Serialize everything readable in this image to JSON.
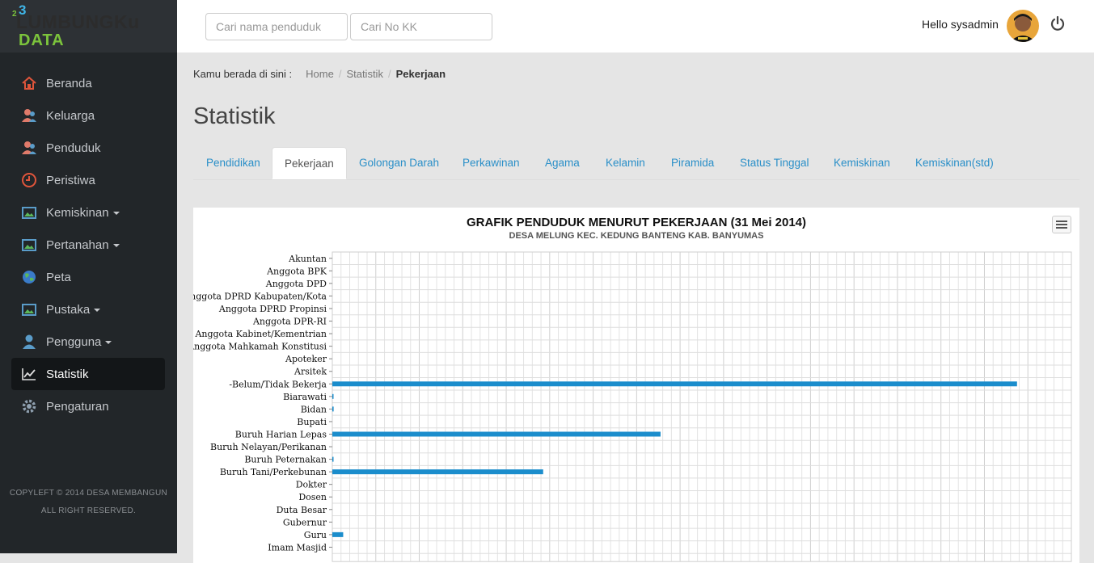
{
  "logo": {
    "mark_small": "2",
    "mark_big": "3",
    "name": "LUMBUNGKu",
    "sub": "DATA"
  },
  "sidebar": {
    "items": [
      {
        "label": "Beranda",
        "icon": "home-icon",
        "caret": false,
        "color": "#e0553b"
      },
      {
        "label": "Keluarga",
        "icon": "family-icon",
        "caret": false,
        "color": "#e07a6a"
      },
      {
        "label": "Penduduk",
        "icon": "people-icon",
        "caret": false,
        "color": "#e07a6a"
      },
      {
        "label": "Peristiwa",
        "icon": "clock-icon",
        "caret": false,
        "color": "#e0553b"
      },
      {
        "label": "Kemiskinan",
        "icon": "image-icon",
        "caret": true,
        "color": "#5a9cc9"
      },
      {
        "label": "Pertanahan",
        "icon": "image-icon",
        "caret": true,
        "color": "#5a9cc9"
      },
      {
        "label": "Peta",
        "icon": "globe-icon",
        "caret": false,
        "color": "#5cb85c"
      },
      {
        "label": "Pustaka",
        "icon": "image-icon",
        "caret": true,
        "color": "#5a9cc9"
      },
      {
        "label": "Pengguna",
        "icon": "user-icon",
        "caret": true,
        "color": "#5a9cc9"
      },
      {
        "label": "Statistik",
        "icon": "chart-line-icon",
        "caret": false,
        "color": "#e0e0e0",
        "active": true
      },
      {
        "label": "Pengaturan",
        "icon": "gear-icon",
        "caret": false,
        "color": "#8fa0b0"
      }
    ],
    "footer_line1": "COPYLEFT © 2014 DESA MEMBANGUN",
    "footer_line2": "ALL RIGHT RESERVED."
  },
  "topbar": {
    "search_name_placeholder": "Cari nama penduduk",
    "search_kk_placeholder": "Cari No KK",
    "greeting": "Hello sysadmin"
  },
  "breadcrumb": {
    "label": "Kamu berada di sini :",
    "items": [
      "Home",
      "Statistik",
      "Pekerjaan"
    ]
  },
  "page": {
    "title": "Statistik"
  },
  "tabs": [
    {
      "label": "Pendidikan"
    },
    {
      "label": "Pekerjaan",
      "active": true
    },
    {
      "label": "Golongan Darah"
    },
    {
      "label": "Perkawinan"
    },
    {
      "label": "Agama"
    },
    {
      "label": "Kelamin"
    },
    {
      "label": "Piramida"
    },
    {
      "label": "Status Tinggal"
    },
    {
      "label": "Kemiskinan"
    },
    {
      "label": "Kemiskinan(std)"
    }
  ],
  "chart_data": {
    "type": "bar",
    "orientation": "horizontal",
    "title": "GRAFIK PENDUDUK MENURUT PEKERJAAN (31 Mei 2014)",
    "subtitle": "DESA MELUNG KEC. KEDUNG BANTENG KAB. BANYUMAS",
    "categories": [
      "Akuntan",
      "Anggota BPK",
      "Anggota DPD",
      "Anggota DPRD Kabupaten/Kota",
      "Anggota DPRD Propinsi",
      "Anggota DPR-RI",
      "Anggota Kabinet/Kementrian",
      "Anggota Mahkamah Konstitusi",
      "Apoteker",
      "Arsitek",
      "-Belum/Tidak Bekerja",
      "Biarawati",
      "Bidan",
      "Bupati",
      "Buruh Harian Lepas",
      "Buruh Nelayan/Perikanan",
      "Buruh Peternakan",
      "Buruh Tani/Perkebunan",
      "Dokter",
      "Dosen",
      "Duta Besar",
      "Gubernur",
      "Guru",
      "Imam Masjid"
    ],
    "values": [
      0,
      0,
      0,
      0,
      0,
      0,
      0,
      0,
      0,
      0,
      1575,
      2,
      3,
      0,
      755,
      0,
      2,
      485,
      0,
      0,
      0,
      0,
      25,
      0
    ],
    "xlim": [
      0,
      1700
    ],
    "bar_color": "#1b8dcc",
    "grid": true
  }
}
